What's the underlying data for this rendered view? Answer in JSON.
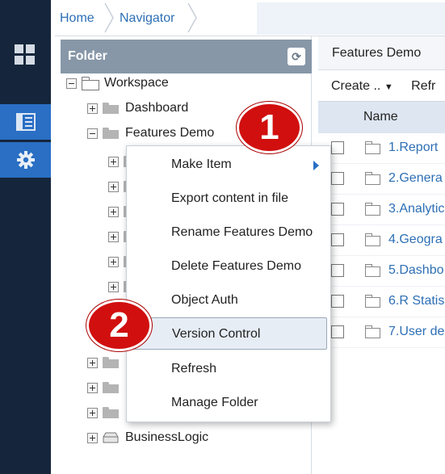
{
  "breadcrumb": {
    "home": "Home",
    "navigator": "Navigator"
  },
  "folder_panel": {
    "title": "Folder",
    "tree": {
      "workspace": "Workspace",
      "dashboard": "Dashboard",
      "features_demo": "Features Demo",
      "business_logic": "BusinessLogic"
    }
  },
  "content_panel": {
    "title": "Features Demo",
    "create_label": "Create ..",
    "refresh_label": "Refr",
    "name_column": "Name",
    "rows": [
      "1.Report",
      "2.Genera",
      "3.Analytic",
      "4.Geogra",
      "5.Dashbo",
      "6.R Statis",
      "7.User de"
    ]
  },
  "context_menu": {
    "items": [
      "Make Item",
      "Export content in file",
      "Rename Features Demo",
      "Delete Features Demo",
      "Object Auth",
      "Version Control",
      "Refresh",
      "Manage Folder"
    ],
    "highlighted": "Version Control"
  },
  "callouts": {
    "step1": "1",
    "step2": "2"
  },
  "icons": {
    "app": "windows-logo-icon",
    "navigator_tab": "list-panel-icon",
    "settings_tab": "gear-icon",
    "refresh": "refresh-icon",
    "dropdown": "caret-down-icon",
    "submenu": "chevron-right-icon"
  },
  "colors": {
    "rail": "#15263c",
    "rail_active": "#2a6fc4",
    "panel_header": "#8797a8",
    "link": "#2d6fb5",
    "callout": "#d10f0f",
    "menu_highlight": "#e7edf5"
  }
}
